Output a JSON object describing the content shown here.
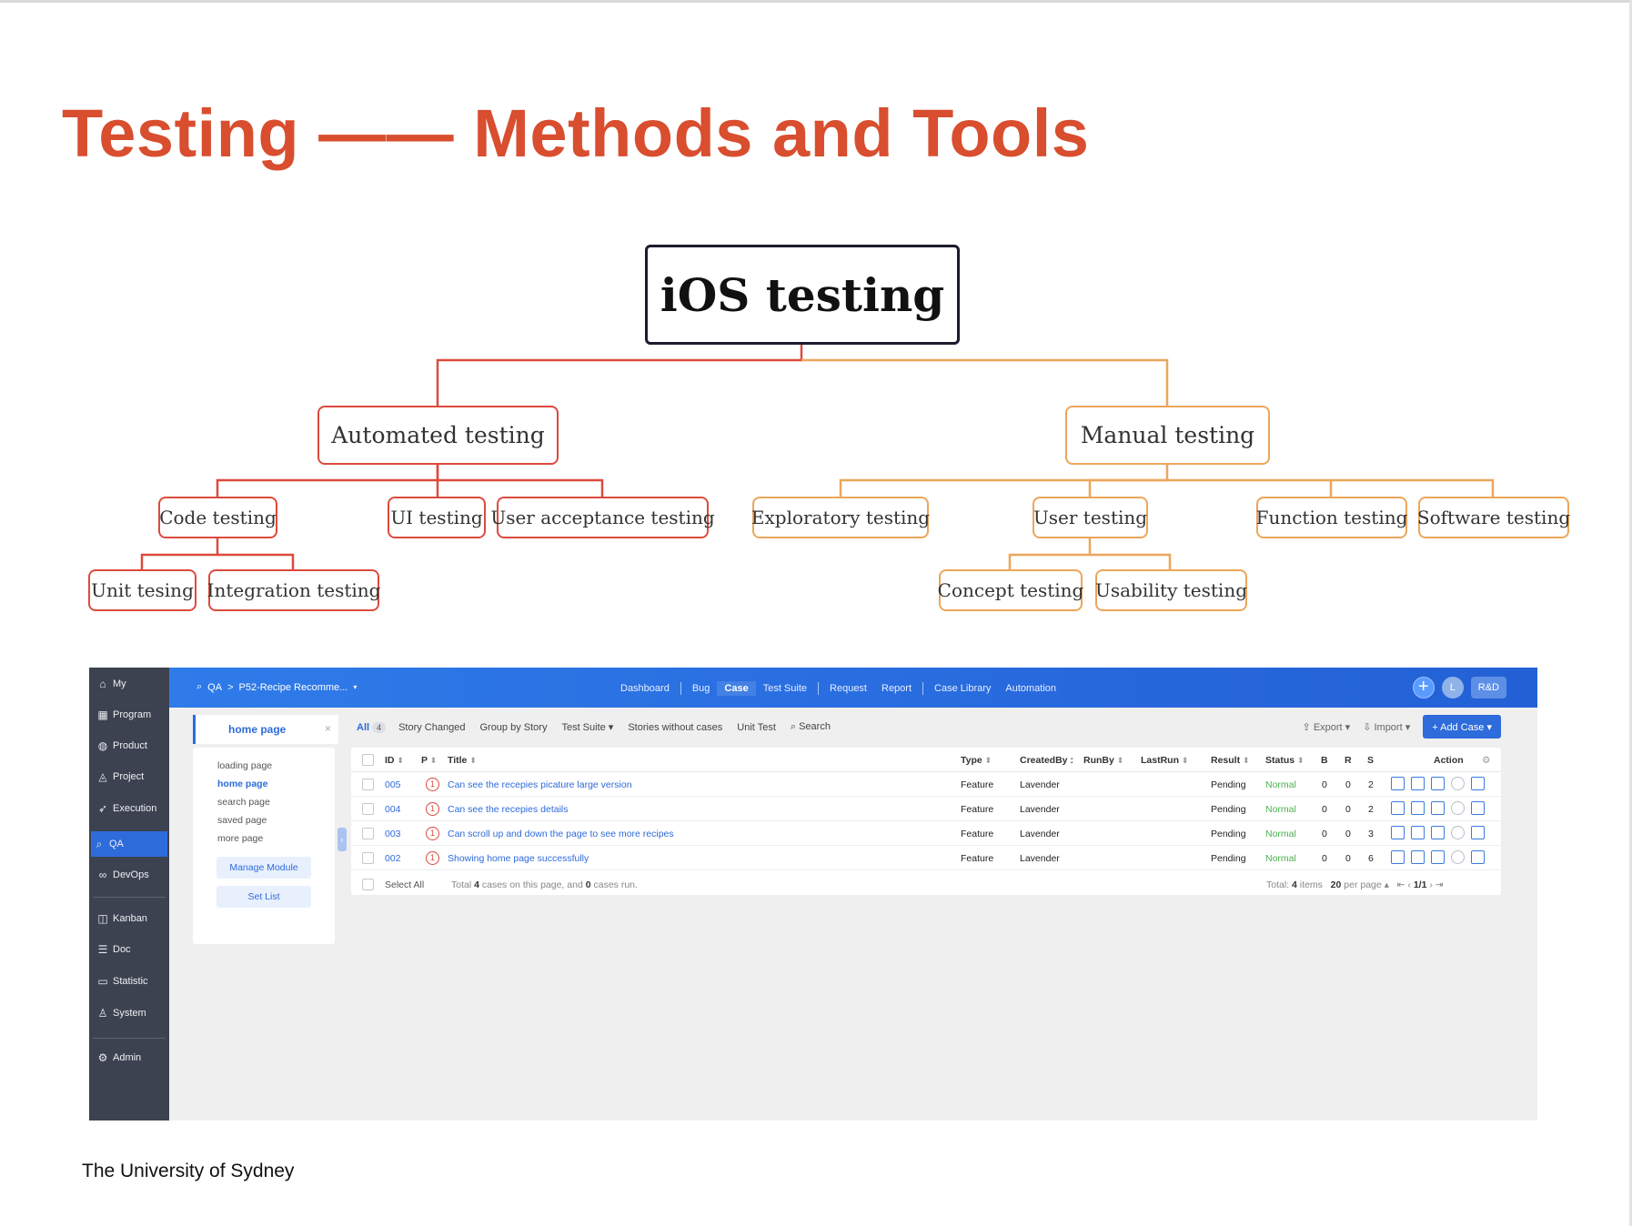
{
  "slide": {
    "title": "Testing —— Methods and Tools",
    "footer": "The University of Sydney"
  },
  "mindmap": {
    "root": "iOS testing",
    "automated": {
      "label": "Automated testing",
      "code": "Code testing",
      "ui": "UI testing",
      "uat": "User acceptance testing",
      "unit": "Unit tesing",
      "integration": "Integration testing"
    },
    "manual": {
      "label": "Manual testing",
      "exploratory": "Exploratory testing",
      "user": "User testing",
      "function": "Function testing",
      "software": "Software testing",
      "concept": "Concept testing",
      "usability": "Usability testing"
    },
    "colors": {
      "root_border": "#1b1b2f",
      "automated": "#dc4a3d",
      "manual": "#eca65a",
      "title": "#d84e2f"
    }
  },
  "app": {
    "sidebar": [
      {
        "label": "My",
        "icon": "home-icon"
      },
      {
        "label": "Program",
        "icon": "grid-icon"
      },
      {
        "label": "Product",
        "icon": "bulb-icon"
      },
      {
        "label": "Project",
        "icon": "bag-icon"
      },
      {
        "label": "Execution",
        "icon": "run-icon"
      },
      {
        "label": "QA",
        "icon": "search-icon"
      },
      {
        "label": "DevOps",
        "icon": "infinity-icon"
      },
      {
        "label": "Kanban",
        "icon": "kanban-icon"
      },
      {
        "label": "Doc",
        "icon": "doc-icon"
      },
      {
        "label": "Statistic",
        "icon": "monitor-icon"
      },
      {
        "label": "System",
        "icon": "users-icon"
      },
      {
        "label": "Admin",
        "icon": "gear-icon"
      }
    ],
    "topbar": {
      "crumb_root": "QA",
      "crumb_sep": ">",
      "project": "P52-Recipe Recomme...",
      "nav": [
        "Dashboard",
        "Bug",
        "Case",
        "Test Suite",
        "Request",
        "Report",
        "Case Library",
        "Automation"
      ],
      "active_nav": "Case",
      "plus": "+",
      "avatar": "L",
      "badge": "R&D"
    },
    "module_tab": {
      "label": "home page",
      "close": "×"
    },
    "modules": [
      "loading page",
      "home page",
      "search page",
      "saved page",
      "more page"
    ],
    "active_module": "home page",
    "manage_module": "Manage Module",
    "set_list": "Set List",
    "filters": {
      "all": "All",
      "all_count": "4",
      "items": [
        "Story Changed",
        "Group by Story",
        "Test Suite ▾",
        "Stories without cases",
        "Unit Test"
      ],
      "search": "Search",
      "export": "Export ▾",
      "import": "Import ▾",
      "add_case": "+ Add Case  ▾"
    },
    "table": {
      "headers": {
        "id": "ID",
        "p": "P",
        "title": "Title",
        "type": "Type",
        "created_by": "CreatedBy",
        "run_by": "RunBy",
        "last_run": "LastRun",
        "result": "Result",
        "status": "Status",
        "b": "B",
        "r": "R",
        "s": "S",
        "action": "Action"
      },
      "rows": [
        {
          "id": "005",
          "p": "1",
          "title": "Can see the recepies picature large version",
          "type": "Feature",
          "created_by": "Lavender",
          "result": "Pending",
          "status": "Normal",
          "b": "0",
          "r": "0",
          "s": "2"
        },
        {
          "id": "004",
          "p": "1",
          "title": "Can see the recepies details",
          "type": "Feature",
          "created_by": "Lavender",
          "result": "Pending",
          "status": "Normal",
          "b": "0",
          "r": "0",
          "s": "2"
        },
        {
          "id": "003",
          "p": "1",
          "title": "Can scroll up and down the page to see more recipes",
          "type": "Feature",
          "created_by": "Lavender",
          "result": "Pending",
          "status": "Normal",
          "b": "0",
          "r": "0",
          "s": "3"
        },
        {
          "id": "002",
          "p": "1",
          "title": "Showing home page successfully",
          "type": "Feature",
          "created_by": "Lavender",
          "result": "Pending",
          "status": "Normal",
          "b": "0",
          "r": "0",
          "s": "6"
        }
      ],
      "select_all": "Select All",
      "summary_pre": "Total",
      "summary_cases": "4",
      "summary_mid": "cases on this page, and",
      "summary_run": "0",
      "summary_post": "cases run.",
      "total_items_pre": "Total:",
      "total_items": "4",
      "total_items_post": "items",
      "per_page": "20",
      "per_page_post": "per page ▴",
      "page": "1/1"
    }
  }
}
